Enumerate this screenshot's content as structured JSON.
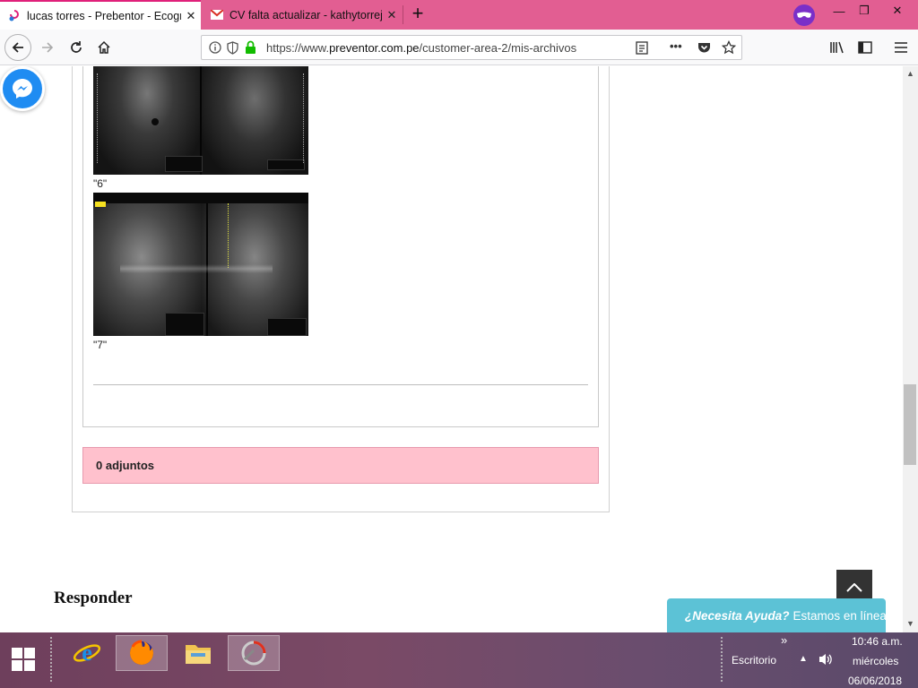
{
  "tabs": [
    {
      "title": "lucas torres - Prebentor - Ecogr",
      "close": "✕"
    },
    {
      "title": "CV falta actualizar - kathytorrej",
      "close": "✕"
    }
  ],
  "new_tab": "+",
  "window": {
    "minimize": "—",
    "maximize": "❐",
    "close": "✕"
  },
  "nav": {
    "url_prefix": "https://www.",
    "url_domain": "preventor.com.pe",
    "url_path": "/customer-area-2/mis-archivos",
    "more": "•••"
  },
  "page": {
    "captions": [
      "\"6\"",
      "\"7\""
    ],
    "attachments": "0 adjuntos",
    "responder": "Responder",
    "help_bold": "¿Necesita Ayuda?",
    "help_text": "Estamos en línea"
  },
  "taskbar": {
    "desktop": "Escritorio",
    "chevron": "»",
    "time": "10:46 a.m.",
    "day": "miércoles",
    "date": "06/06/2018"
  },
  "colors": {
    "tab_bar": "#e25e92",
    "attach_bg": "#ffc1cd",
    "help_bg": "#5cc2d6",
    "messenger": "#1f8cf2"
  }
}
